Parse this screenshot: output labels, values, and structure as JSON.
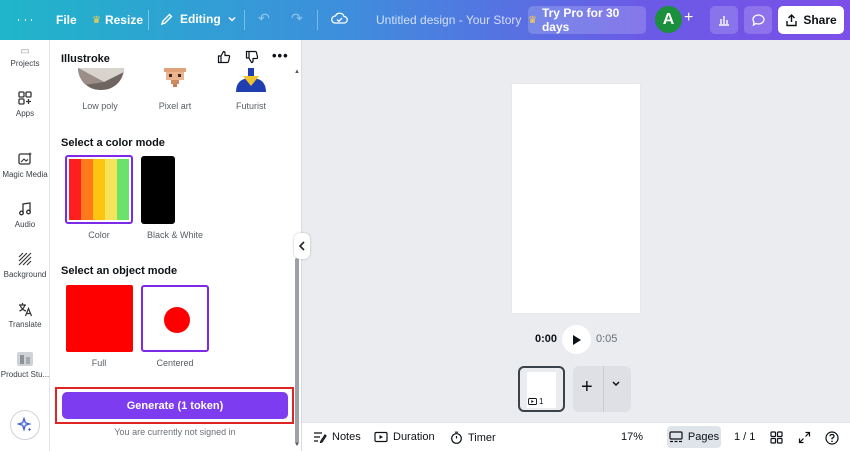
{
  "topbar": {
    "file_label": "File",
    "resize_label": "Resize",
    "editing_label": "Editing",
    "doc_title": "Untitled design - Your Story",
    "try_pro_label": "Try Pro for 30 days",
    "avatar_initial": "A",
    "share_label": "Share"
  },
  "rail": {
    "items": [
      {
        "label": "Projects",
        "icon": "folder-icon"
      },
      {
        "label": "Apps",
        "icon": "apps-icon"
      },
      {
        "label": "Magic Media",
        "icon": "magic-media-icon"
      },
      {
        "label": "Audio",
        "icon": "music-note-icon"
      },
      {
        "label": "Background",
        "icon": "background-icon"
      },
      {
        "label": "Translate",
        "icon": "translate-icon"
      },
      {
        "label": "Product Stu...",
        "icon": "product-studio-icon"
      }
    ]
  },
  "panel": {
    "title": "Illustroke",
    "styles": [
      {
        "label": "Low poly"
      },
      {
        "label": "Pixel art"
      },
      {
        "label": "Futurist"
      }
    ],
    "color_mode_heading": "Select a color mode",
    "color_modes": [
      {
        "label": "Color",
        "selected": true
      },
      {
        "label": "Black & White",
        "selected": false
      }
    ],
    "object_mode_heading": "Select an object mode",
    "object_modes": [
      {
        "label": "Full",
        "selected": false
      },
      {
        "label": "Centered",
        "selected": true
      }
    ],
    "generate_label": "Generate (1 token)",
    "signin_note": "You are currently not signed in"
  },
  "canvas": {
    "time_current": "0:00",
    "time_total": "0:05",
    "page_number": "1"
  },
  "bottombar": {
    "notes_label": "Notes",
    "duration_label": "Duration",
    "timer_label": "Timer",
    "zoom": "17%",
    "pages_label": "Pages",
    "page_count": "1 / 1"
  },
  "colors": {
    "accent_purple": "#7d2ae8",
    "generate_button": "#7d3cf0",
    "highlight_red": "#e02424"
  }
}
